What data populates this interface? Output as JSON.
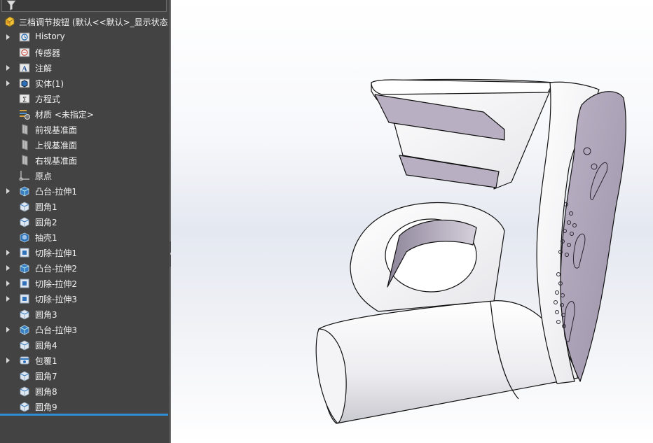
{
  "feature_tree": {
    "root": {
      "label": "三档调节按钮 (默认<<默认>_显示状态",
      "icon": "part-icon"
    },
    "items": [
      {
        "label": "History",
        "icon": "history-icon",
        "expandable": true
      },
      {
        "label": "传感器",
        "icon": "sensors-icon",
        "expandable": false
      },
      {
        "label": "注解",
        "icon": "annotations-icon",
        "expandable": true
      },
      {
        "label": "实体(1)",
        "icon": "solid-bodies-icon",
        "expandable": true
      },
      {
        "label": "方程式",
        "icon": "equations-icon",
        "expandable": false
      },
      {
        "label": "材质 <未指定>",
        "icon": "material-icon",
        "expandable": false
      },
      {
        "label": "前视基准面",
        "icon": "plane-icon",
        "expandable": false
      },
      {
        "label": "上视基准面",
        "icon": "plane-icon",
        "expandable": false
      },
      {
        "label": "右视基准面",
        "icon": "plane-icon",
        "expandable": false
      },
      {
        "label": "原点",
        "icon": "origin-icon",
        "expandable": false
      },
      {
        "label": "凸台-拉伸1",
        "icon": "boss-extrude-icon",
        "expandable": true
      },
      {
        "label": "圆角1",
        "icon": "fillet-icon",
        "expandable": false
      },
      {
        "label": "圆角2",
        "icon": "fillet-icon",
        "expandable": false
      },
      {
        "label": "抽壳1",
        "icon": "shell-icon",
        "expandable": false
      },
      {
        "label": "切除-拉伸1",
        "icon": "cut-extrude-icon",
        "expandable": true
      },
      {
        "label": "凸台-拉伸2",
        "icon": "boss-extrude-icon",
        "expandable": true
      },
      {
        "label": "切除-拉伸2",
        "icon": "cut-extrude-icon",
        "expandable": true
      },
      {
        "label": "切除-拉伸3",
        "icon": "cut-extrude-icon",
        "expandable": true
      },
      {
        "label": "圆角3",
        "icon": "fillet-icon",
        "expandable": false
      },
      {
        "label": "凸台-拉伸3",
        "icon": "boss-extrude-icon",
        "expandable": true
      },
      {
        "label": "圆角4",
        "icon": "fillet-icon",
        "expandable": false
      },
      {
        "label": "包覆1",
        "icon": "wrap-icon",
        "expandable": true
      },
      {
        "label": "圆角7",
        "icon": "fillet-icon",
        "expandable": false
      },
      {
        "label": "圆角8",
        "icon": "fillet-icon",
        "expandable": false
      },
      {
        "label": "圆角9",
        "icon": "fillet-icon",
        "expandable": false
      }
    ]
  },
  "colors": {
    "panel_bg": "#434343",
    "rollback_bar": "#2f8fd6",
    "model_face": "#ffffff",
    "model_tinted_face": "#b3a9bd"
  }
}
